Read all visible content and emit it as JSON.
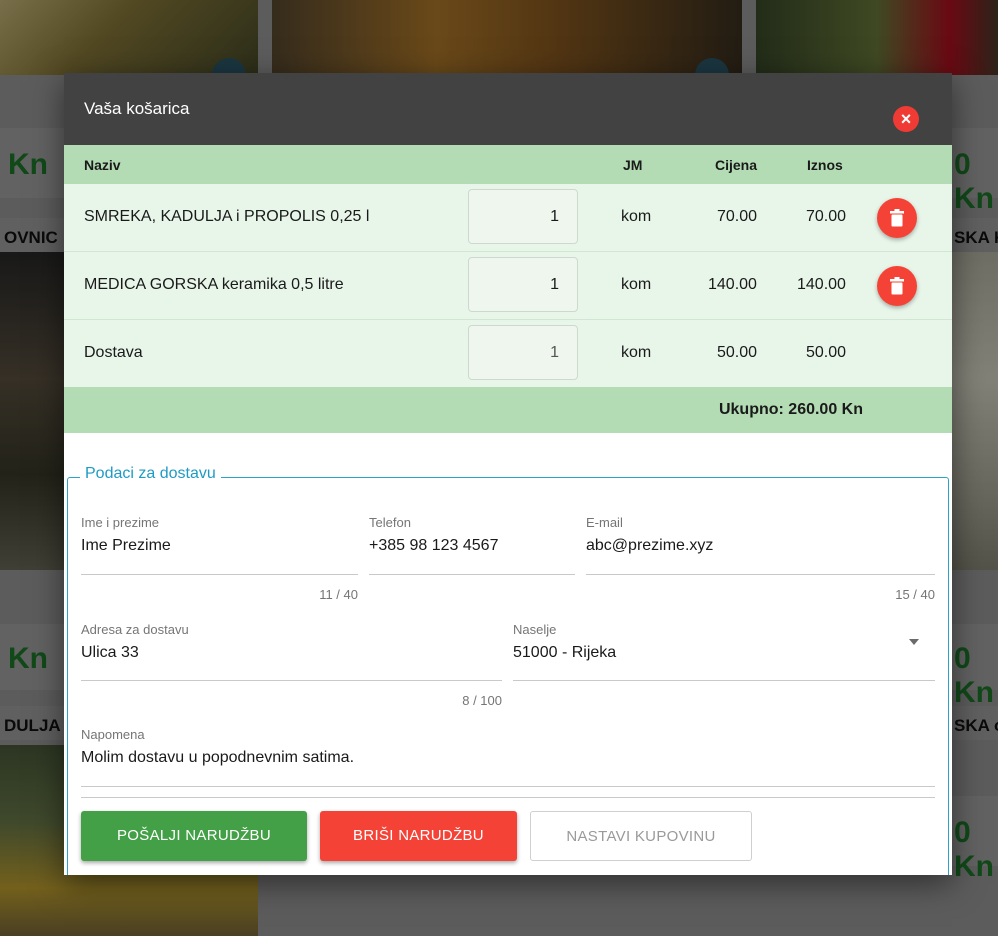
{
  "background": {
    "left_prices": [
      "Kn",
      "Kn"
    ],
    "right_prices": [
      "0 Kn",
      "0 Kn",
      "0 Kn"
    ],
    "left_names": [
      "OVNIC",
      "DULJA"
    ],
    "right_names": [
      "SKA K",
      "SKA o"
    ]
  },
  "modal": {
    "title": "Vaša košarica",
    "close_icon": "close-icon",
    "cart": {
      "headers": {
        "name": "Naziv",
        "unit": "JM",
        "price": "Cijena",
        "amount": "Iznos"
      },
      "rows": [
        {
          "name": "SMREKA, KADULJA i PROPOLIS 0,25 l",
          "qty": "1",
          "unit": "kom",
          "price": "70.00",
          "amount": "70.00",
          "deletable": true
        },
        {
          "name": "MEDICA GORSKA keramika 0,5 litre",
          "qty": "1",
          "unit": "kom",
          "price": "140.00",
          "amount": "140.00",
          "deletable": true
        },
        {
          "name": "Dostava",
          "qty": "1",
          "unit": "kom",
          "price": "50.00",
          "amount": "50.00",
          "deletable": false
        }
      ],
      "total": "Ukupno: 260.00 Kn"
    },
    "delivery": {
      "legend": "Podaci za dostavu",
      "name": {
        "label": "Ime i prezime",
        "value": "Ime Prezime",
        "counter": "11 / 40"
      },
      "phone": {
        "label": "Telefon",
        "value": "+385 98 123 4567"
      },
      "email": {
        "label": "E-mail",
        "value": "abc@prezime.xyz",
        "counter": "15 / 40"
      },
      "address": {
        "label": "Adresa za dostavu",
        "value": "Ulica 33",
        "counter": "8 / 100"
      },
      "city": {
        "label": "Naselje",
        "value": "51000 - Rijeka"
      },
      "note": {
        "label": "Napomena",
        "value": "Molim dostavu u popodnevnim satima."
      }
    },
    "buttons": {
      "send": "POŠALJI NARUDŽBU",
      "delete": "BRIŠI NARUDŽBU",
      "continue": "NASTAVI KUPOVINU"
    },
    "colors": {
      "header": "#424242",
      "cart_green": "#b3dcb4",
      "row_green": "#e8f5e9",
      "accent": "#1e9bc4",
      "send": "#43a047",
      "danger": "#f44336"
    }
  }
}
